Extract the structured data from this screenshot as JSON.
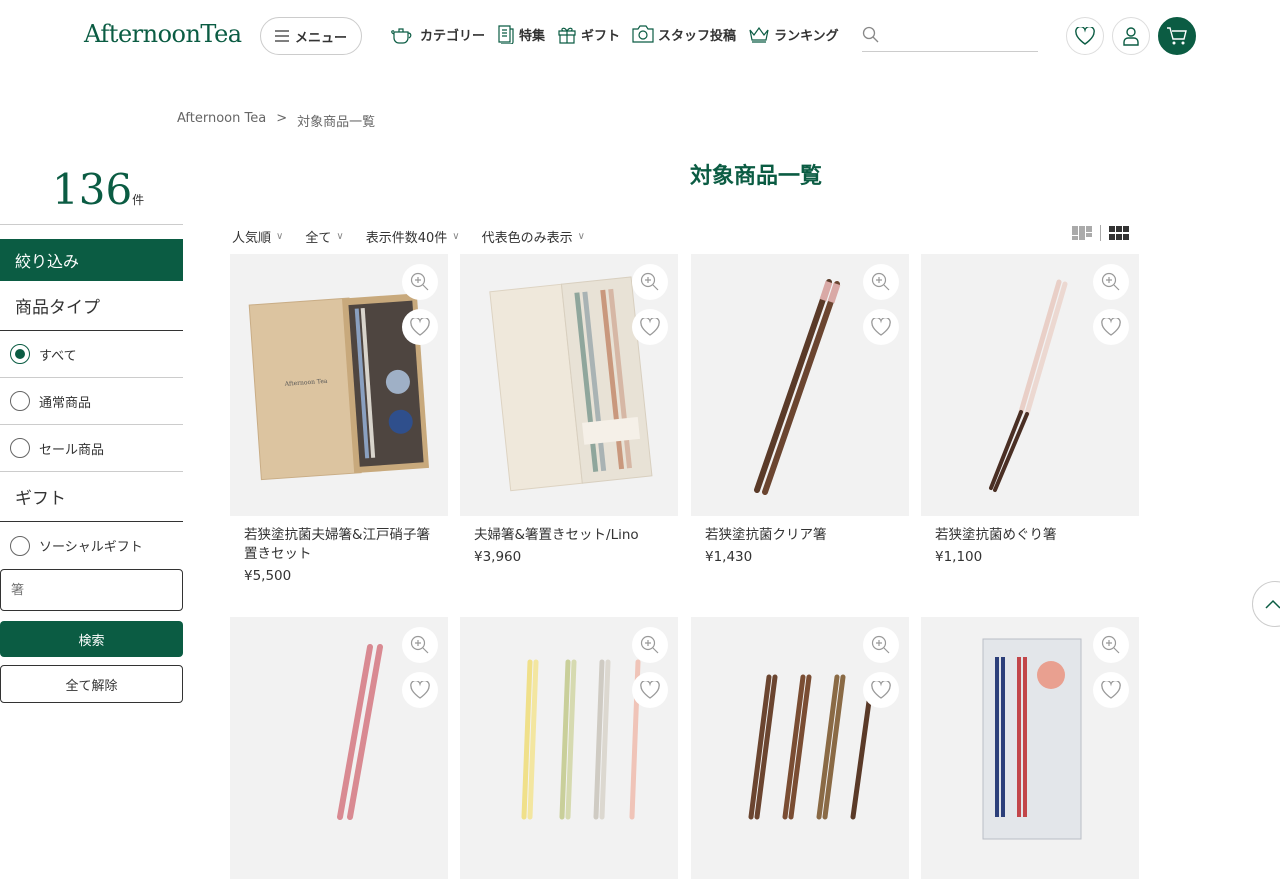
{
  "header": {
    "logo": "AfternoonTea",
    "menu_label": "メニュー",
    "nav": [
      {
        "label": "カテゴリー",
        "icon": "teapot-icon"
      },
      {
        "label": "特集",
        "icon": "document-icon"
      },
      {
        "label": "ギフト",
        "icon": "gift-icon"
      },
      {
        "label": "スタッフ投稿",
        "icon": "camera-icon"
      },
      {
        "label": "ランキング",
        "icon": "crown-icon"
      }
    ],
    "search_placeholder": "",
    "icons": [
      "heart-icon",
      "user-icon",
      "cart-icon"
    ]
  },
  "breadcrumb": {
    "home": "Afternoon Tea",
    "sep": ">",
    "current": "対象商品一覧"
  },
  "sidebar": {
    "count": "136",
    "count_unit": "件",
    "filter_label": "絞り込み",
    "product_type_title": "商品タイプ",
    "product_types": [
      {
        "label": "すべて",
        "selected": true
      },
      {
        "label": "通常商品",
        "selected": false
      },
      {
        "label": "セール商品",
        "selected": false
      }
    ],
    "gift_title": "ギフト",
    "gift_options": [
      {
        "label": "ソーシャルギフト",
        "selected": false
      }
    ],
    "keyword_placeholder": "箸",
    "search_button": "検索",
    "clear_button": "全て解除"
  },
  "main": {
    "title": "対象商品一覧",
    "sort": [
      {
        "label": "人気順"
      },
      {
        "label": "全て"
      },
      {
        "label": "表示件数40件"
      },
      {
        "label": "代表色のみ表示"
      }
    ],
    "products": [
      {
        "name": "若狭塗抗菌夫婦箸&江戸硝子箸置きセット",
        "price": "¥5,500"
      },
      {
        "name": "夫婦箸&箸置きセット/Lino",
        "price": "¥3,960"
      },
      {
        "name": "若狭塗抗菌クリア箸",
        "price": "¥1,430"
      },
      {
        "name": "若狭塗抗菌めぐり箸",
        "price": "¥1,100"
      },
      {
        "name": "",
        "price": ""
      },
      {
        "name": "",
        "price": ""
      },
      {
        "name": "",
        "price": ""
      },
      {
        "name": "",
        "price": ""
      }
    ]
  },
  "colors": {
    "brand": "#0b5c43",
    "card_bg": "#f2f2f2"
  }
}
